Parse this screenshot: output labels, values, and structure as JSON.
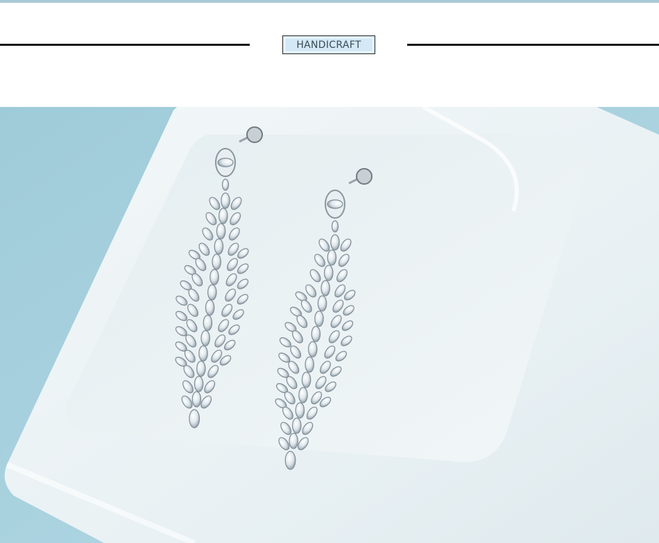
{
  "header": {
    "badge_label": "HANDICRAFT"
  },
  "photo": {
    "subject_icon": "earrings-photo-icon",
    "background_color": "#a6d0de",
    "dish_color": "#eef4f6"
  },
  "colors": {
    "accent": "#d3e9f6",
    "rule": "#111111"
  }
}
